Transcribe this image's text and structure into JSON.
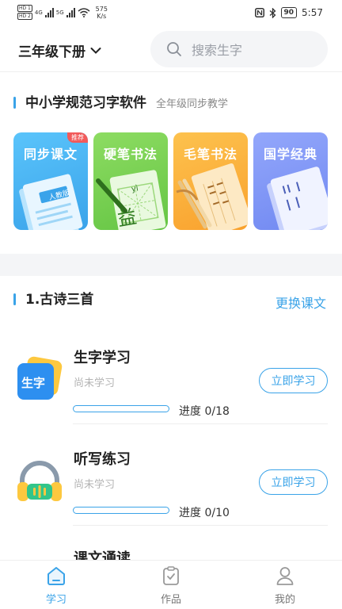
{
  "status_bar": {
    "hd1": "HD 1",
    "hd2": "HD 2",
    "net1": "4G",
    "net2": "5G",
    "speed_value": "575",
    "speed_unit": "K/s",
    "battery": "90",
    "time": "5:57"
  },
  "header": {
    "grade_selector": "三年级下册",
    "search_placeholder": "搜索生字"
  },
  "app_section": {
    "title": "中小学规范习字软件",
    "subtitle": "全年级同步教学",
    "cards": [
      {
        "label": "同步课文",
        "badge": "推荐",
        "book_label": "人教版",
        "color": "#46b6f5"
      },
      {
        "label": "硬笔书法",
        "tile_char": "益",
        "pinyin": "yì",
        "color": "#7bd152"
      },
      {
        "label": "毛笔书法",
        "color": "#fbae3c"
      },
      {
        "label": "国学经典",
        "color": "#7e97f5"
      }
    ]
  },
  "lesson": {
    "title": "1.古诗三首",
    "change_button": "更换课文",
    "items": [
      {
        "icon": "shengzi-icon",
        "icon_text": "生字",
        "title": "生字学习",
        "status": "尚未学习",
        "progress": 0,
        "progress_text": "进度 0/18",
        "button": "立即学习"
      },
      {
        "icon": "headphones-icon",
        "title": "听写练习",
        "status": "尚未学习",
        "progress": 0,
        "progress_text": "进度 0/10",
        "button": "立即学习"
      },
      {
        "icon": "reading-icon",
        "title": "课文通读"
      }
    ]
  },
  "tabbar": {
    "tabs": [
      {
        "label": "学习",
        "icon": "home-icon",
        "active": true
      },
      {
        "label": "作品",
        "icon": "clipboard-check-icon",
        "active": false
      },
      {
        "label": "我的",
        "icon": "user-icon",
        "active": false
      }
    ]
  },
  "colors": {
    "accent": "#3aa3e8",
    "badge": "#f25a5a"
  }
}
